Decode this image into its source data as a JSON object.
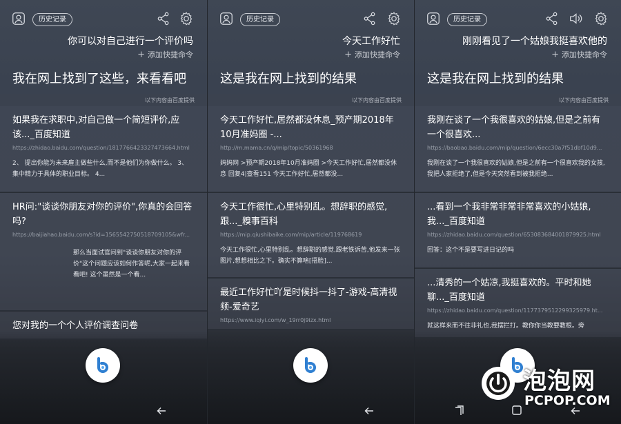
{
  "common": {
    "history_label": "历史记录",
    "add_command_label": "添加快捷命令",
    "provider_note": "以下内容由百度提供",
    "icons": [
      "user-icon",
      "share-icon",
      "gear-icon",
      "volume-icon",
      "bixby-icon",
      "back-icon",
      "recent-apps-icon",
      "home-icon"
    ]
  },
  "screens": [
    {
      "query": "你可以对自己进行一个评价吗",
      "reply": "我在网上找到了这些，来看看吧",
      "cards": [
        {
          "title": "如果我在求职中,对自己做一个简短评价,应该..._百度知道",
          "url": "https://zhidao.baidu.com/question/1817766423327473664.html",
          "snippet": "2、 提出你能为未来雇主做些什么,而不是他们为你做什么。 3、 集中精力于具体的职业目标。 4..."
        },
        {
          "title": "HR问:\"谈谈你朋友对你的评价\",你真的会回答吗?",
          "url": "https://baijiahao.baidu.com/s?id=1565542750518709105&wfr...",
          "snippet": "那么当面试官问到\"谈谈你朋友对你的评价\"这个问题应该如何作答呢,大家一起来看看吧! 这个虽然是一个看..."
        },
        {
          "title": "您对我的一个个人评价调查问卷",
          "url": "",
          "snippet": ""
        }
      ]
    },
    {
      "query": "今天工作好忙",
      "reply": "这是我在网上找到的结果",
      "cards": [
        {
          "title": "今天工作好忙,居然都没休息_预产期2018年10月准妈圈 -...",
          "url": "http://m.mama.cn/q/mip/topic/50361968",
          "snippet": "妈妈网 >预产期2018年10月准妈圈 >今天工作好忙,居然都没休息 回复4|查看151 今天工作好忙,居然都没..."
        },
        {
          "title": "今天工作很忙,心里特别乱。想辞职的感觉,跟..._糗事百科",
          "url": "https://mip.qiushibaike.com/mip/article/119768619",
          "snippet": "今天工作很忙,心里特别乱。想辞职的感觉,跟老铁诉苦,他发来一张图片,想想相比之下。确实不算啥[捂脸]..."
        },
        {
          "title": "最近工作好忙吖是时候抖一抖了-游戏-高清视频-爱奇艺",
          "url": "https://www.iqiyi.com/w_19rr0j9izx.html",
          "snippet": ""
        }
      ]
    },
    {
      "query": "刚刚看见了一个姑娘我挺喜欢他的",
      "reply": "这是我在网上找到的结果",
      "cards": [
        {
          "title": "我刚在谈了一个我很喜欢的姑娘,但是之前有一个很喜欢...",
          "url": "https://baobao.baidu.com/mip/question/6ecc30a7f51dbf10d9...",
          "snippet": "我刚在谈了一个我很喜欢的姑娘,但是之前有一个很喜欢我的女孩,我把人家拒绝了,但是今天突然看到被我拒绝..."
        },
        {
          "title": "...看到一个我非常非常非常喜欢的小姑娘,我..._百度知道",
          "url": "https://zhidao.baidu.com/question/653083684001879925.html",
          "snippet": "回答：这个不是要写进日记的吗"
        },
        {
          "title": "...清秀的一个姑凉,我挺喜欢的。平时和她聊..._百度知道",
          "url": "https://zhidao.baidu.com/question/1177379512299325979.ht...",
          "snippet": "就这样来而不往非礼也,我摆拦打。教你你当教要教根。旁"
        }
      ]
    }
  ],
  "watermark": {
    "name": "泡泡网",
    "site": "PCPOP.COM"
  }
}
